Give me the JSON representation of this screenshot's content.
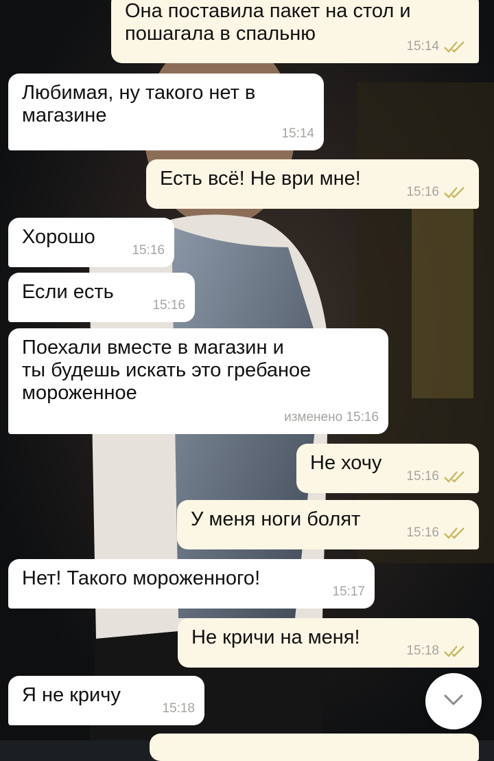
{
  "messages": [
    {
      "dir": "out",
      "text": "Она поставила пакет на стол и\nпошагала в спальню",
      "time": "15:14",
      "status": "read"
    },
    {
      "dir": "in",
      "text": "Любимая, ну такого нет в\nмагазине",
      "time": "15:14"
    },
    {
      "dir": "out",
      "text": "Есть всё! Не ври мне!",
      "time": "15:16",
      "status": "read"
    },
    {
      "dir": "in",
      "text": "Хорошо",
      "time": "15:16"
    },
    {
      "dir": "in",
      "text": "Если есть",
      "time": "15:16"
    },
    {
      "dir": "in",
      "text": "Поехали вместе в магазин и\nты будешь искать это гребаное\nмороженное",
      "time": "изменено 15:16"
    },
    {
      "dir": "out",
      "text": "Не хочу",
      "time": "15:16",
      "status": "read"
    },
    {
      "dir": "out",
      "text": "У меня ноги болят",
      "time": "15:16",
      "status": "read"
    },
    {
      "dir": "in",
      "text": "Нет! Такого мороженного!",
      "time": "15:17"
    },
    {
      "dir": "out",
      "text": "Не кричи на меня!",
      "time": "15:18",
      "status": "read"
    },
    {
      "dir": "in",
      "text": "Я не кричу",
      "time": "15:18"
    }
  ],
  "icons": {
    "read_receipt": "double-check-icon",
    "scroll_down": "chevron-down-icon"
  },
  "colors": {
    "incoming_bubble": "#ffffff",
    "outgoing_bubble": "#fcf6e5",
    "timestamp": "#a4a4a0",
    "read_ticks": "#c9b760"
  }
}
